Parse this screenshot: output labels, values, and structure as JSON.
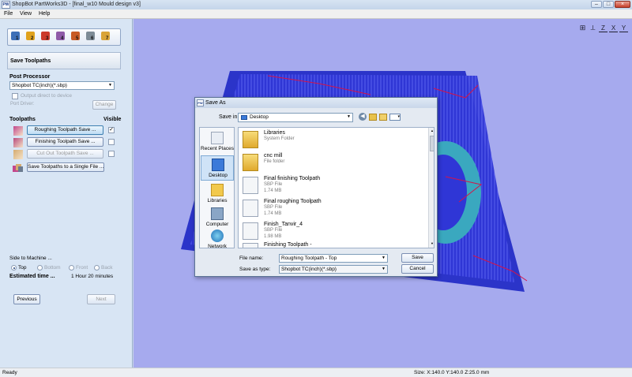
{
  "app": {
    "title": "ShopBot PartWorks3D - [final_w10 Mould design v3]",
    "logo_text": "PW",
    "window_buttons": {
      "minimize": "–",
      "maximize": "□",
      "close": "×"
    }
  },
  "menu": [
    {
      "label": "File"
    },
    {
      "label": "View"
    },
    {
      "label": "Help"
    }
  ],
  "toolbar": {
    "steps": [
      {
        "num": "1",
        "color": "#3d6fb7"
      },
      {
        "num": "2",
        "color": "#e0a21c"
      },
      {
        "num": "3",
        "color": "#cc3a2a"
      },
      {
        "num": "4",
        "color": "#8f5aa8"
      },
      {
        "num": "5",
        "color": "#c85a24"
      },
      {
        "num": "6",
        "color": "#7e8c96"
      },
      {
        "num": "7",
        "color": "#d9a437"
      }
    ]
  },
  "panel": {
    "section_title": "Save Toolpaths",
    "post_processor": {
      "heading": "Post Processor",
      "selected": "Shopbot TC(inch)(*.sbp)",
      "output_direct": "Output direct to device",
      "port_driver": "Port Driver:",
      "change_label": "Change"
    },
    "toolpaths": {
      "heading": "Toolpaths",
      "visible_label": "Visible",
      "items": [
        {
          "label": "Roughing Toolpath Save ...",
          "checked": "✓",
          "icon_color": "#c2478d"
        },
        {
          "label": "Finishing Toolpath Save ...",
          "checked": "",
          "icon_color": "#b84b7d"
        },
        {
          "label": "Cut Out Toolpath Save ...",
          "checked": "",
          "icon_color": "#d5ab70"
        }
      ],
      "save_single": "Save Toolpaths to a Single File ..."
    },
    "side": {
      "heading": "Side to Machine ...",
      "options": [
        {
          "label": "Top"
        },
        {
          "label": "Bottom"
        },
        {
          "label": "Front"
        },
        {
          "label": "Back"
        }
      ]
    },
    "estimated_label": "Estimated time ...",
    "estimated_value": "1 Hour 20 minutes",
    "previous": "Previous",
    "next": "Next"
  },
  "view_icons": [
    {
      "name": "fit-view-icon",
      "glyph": "⊞"
    },
    {
      "name": "iso-view-icon",
      "glyph": "⟂"
    },
    {
      "name": "view-z-icon",
      "glyph": "Z"
    },
    {
      "name": "view-x-icon",
      "glyph": "X"
    },
    {
      "name": "view-y-icon",
      "glyph": "Y"
    }
  ],
  "dialog": {
    "title": "Save As",
    "save_in_label": "Save in:",
    "save_in_value": "Desktop",
    "places": [
      {
        "label": "Recent Places"
      },
      {
        "label": "Desktop"
      },
      {
        "label": "Libraries"
      },
      {
        "label": "Computer"
      },
      {
        "label": "Network"
      }
    ],
    "files": [
      {
        "name": "Libraries",
        "sub1": "System Folder",
        "sub2": ""
      },
      {
        "name": "cnc mill",
        "sub1": "File folder",
        "sub2": ""
      },
      {
        "name": "Final finishing Toolpath",
        "sub1": "SBP File",
        "sub2": "1.74 MB"
      },
      {
        "name": "Final roughing Toolpath",
        "sub1": "SBP File",
        "sub2": "1.74 MB"
      },
      {
        "name": "Finish_Tanvir_4",
        "sub1": "SBP File",
        "sub2": "1.98 MB"
      },
      {
        "name": "Finishing Toolpath  -",
        "sub1": "",
        "sub2": ""
      }
    ],
    "file_name_label": "File name:",
    "file_name_value": "Roughing Toolpath - Top",
    "save_type_label": "Save as type:",
    "save_type_value": "Shopbot TC(inch)(*.sbp)",
    "save_label": "Save",
    "cancel_label": "Cancel"
  },
  "status": {
    "left": "Ready",
    "size": "Size: X:140.0 Y:140.0 Z:25.0 mm"
  }
}
